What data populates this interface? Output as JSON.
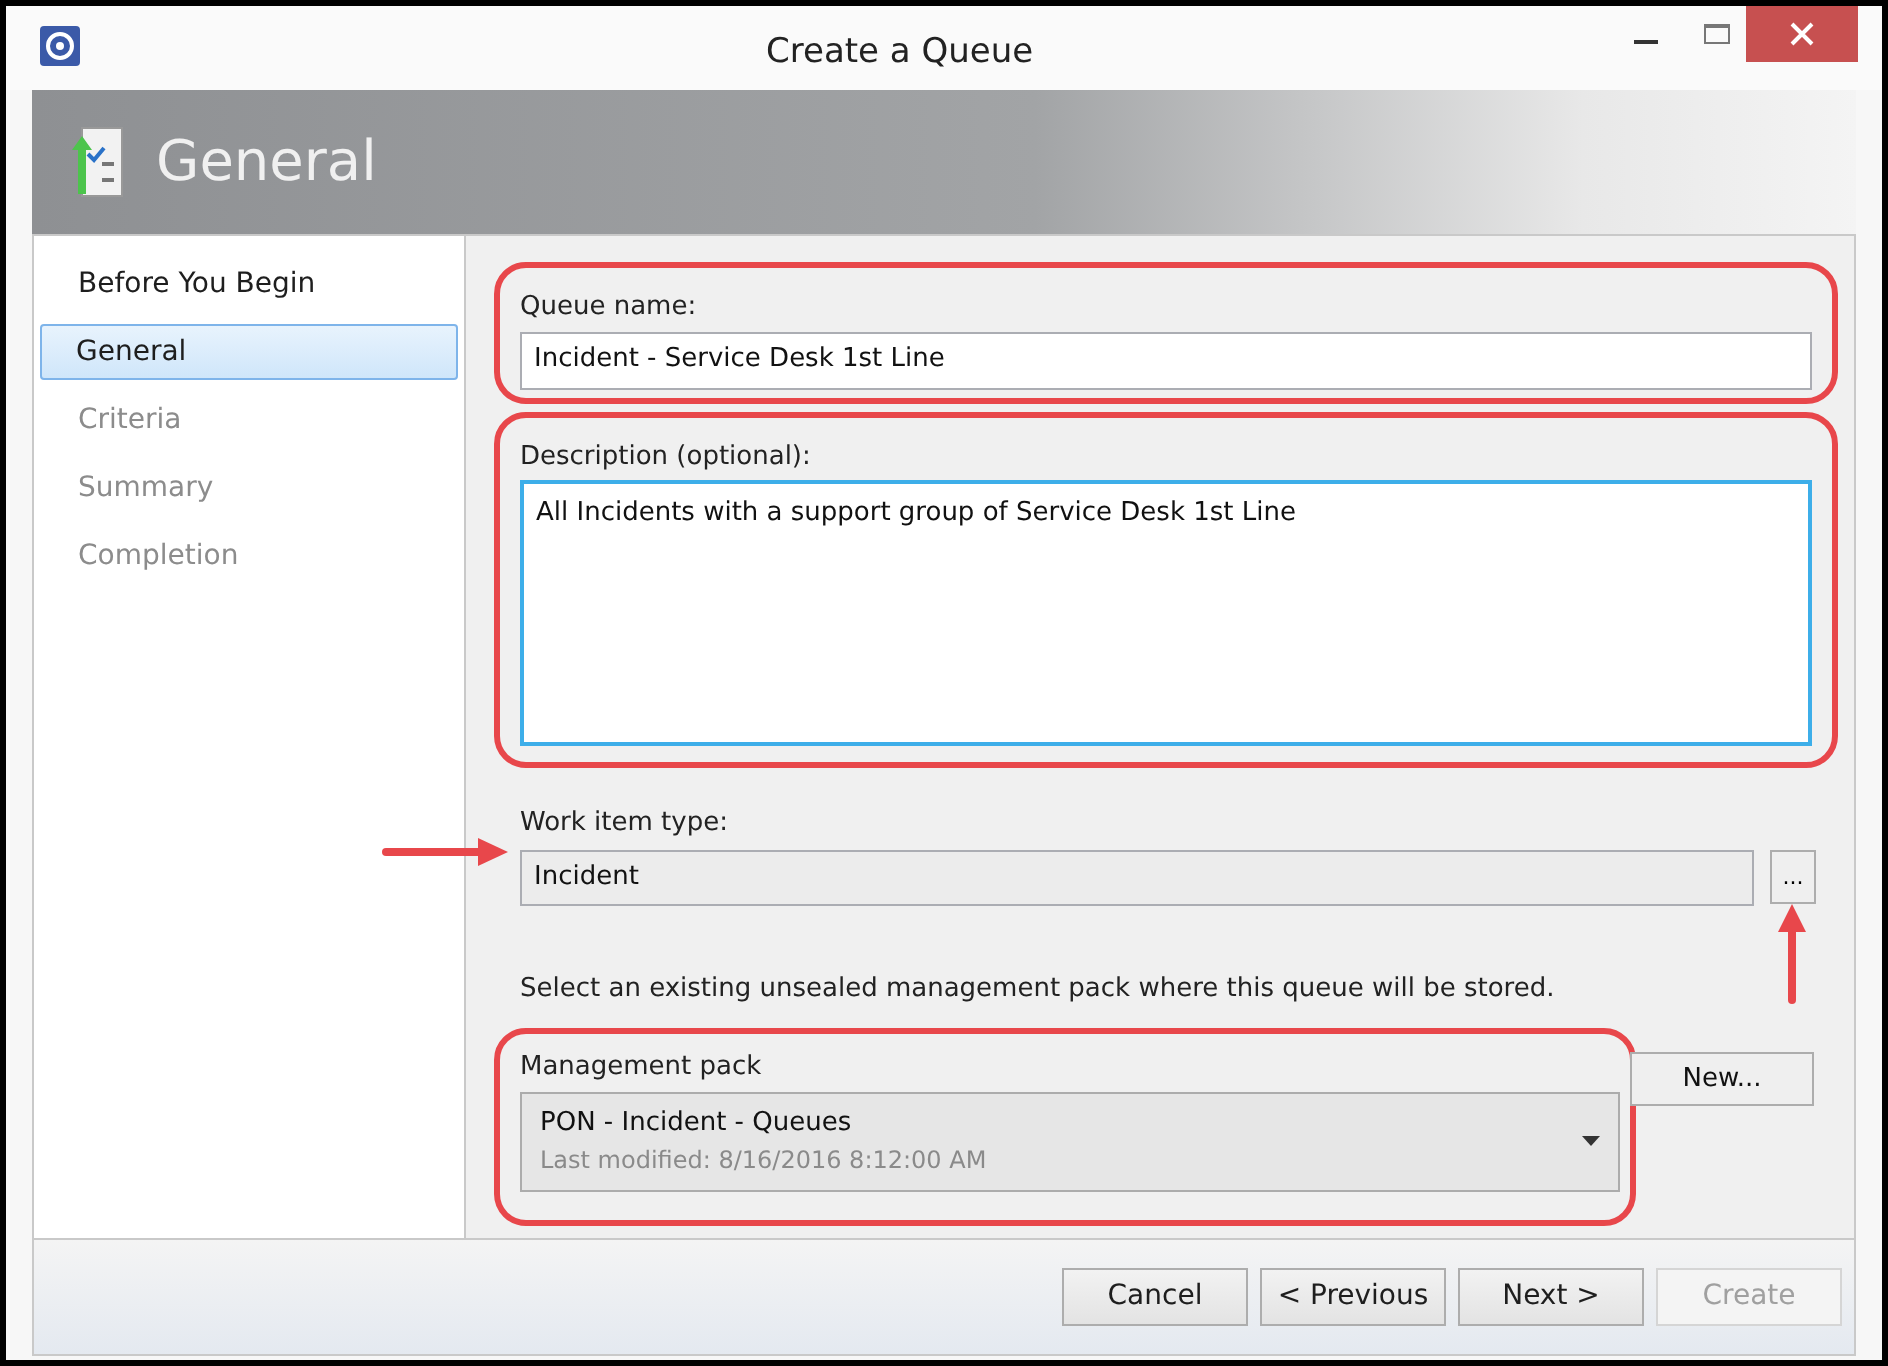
{
  "window": {
    "title": "Create a Queue"
  },
  "header": {
    "title": "General"
  },
  "steps": [
    {
      "label": "Before You Begin",
      "selected": false,
      "disabled": false
    },
    {
      "label": "General",
      "selected": true,
      "disabled": false
    },
    {
      "label": "Criteria",
      "selected": false,
      "disabled": true
    },
    {
      "label": "Summary",
      "selected": false,
      "disabled": true
    },
    {
      "label": "Completion",
      "selected": false,
      "disabled": true
    }
  ],
  "queue_name": {
    "label": "Queue name:",
    "value": "Incident - Service Desk 1st Line"
  },
  "description": {
    "label": "Description (optional):",
    "value": "All Incidents with a support group of Service Desk 1st Line"
  },
  "work_item_type": {
    "label": "Work item type:",
    "value": "Incident",
    "browse_button": "..."
  },
  "instruction": "Select an existing unsealed management pack where this queue will be stored.",
  "management_pack": {
    "label": "Management pack",
    "value": "PON - Incident - Queues",
    "detail": "Last modified:  8/16/2016 8:12:00 AM",
    "new_button": "New..."
  },
  "buttons": [
    {
      "label": "Cancel",
      "disabled": false
    },
    {
      "label": "< Previous",
      "disabled": false
    },
    {
      "label": "Next >",
      "disabled": false
    },
    {
      "label": "Create",
      "disabled": true
    }
  ]
}
